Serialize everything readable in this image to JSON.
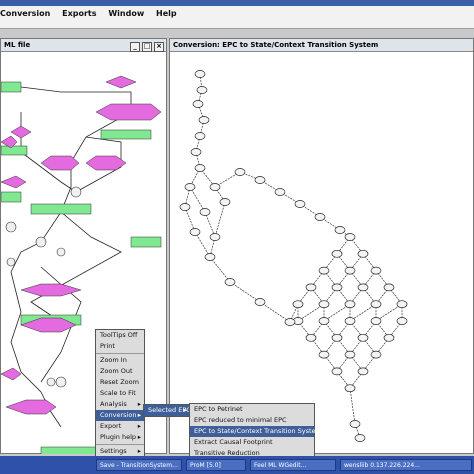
{
  "menubar": {
    "items": [
      "Conversion",
      "Exports",
      "Window",
      "Help"
    ]
  },
  "left_window": {
    "title": "ML file"
  },
  "right_window": {
    "title": "Conversion: EPC to State/Context Transition System"
  },
  "context_menu": {
    "items": [
      "ToolTips Off",
      "Print",
      "Zoom In",
      "Zoom Out",
      "Reset Zoom",
      "Scale to Fit",
      "Analysis",
      "Conversion",
      "Export",
      "Plugin help",
      "Settings"
    ],
    "selected": "Conversion"
  },
  "submenu1": {
    "items": [
      "Selected EPC"
    ]
  },
  "submenu2": {
    "items": [
      "EPC to Petrinet",
      "EPC reduced to minimal EPC",
      "EPC to State/Context Transition System",
      "Extract Causal Footprint",
      "Transitive Reduction"
    ],
    "selected": "EPC to State/Context Transition System"
  },
  "taskbar": {
    "items": [
      "Save - TransitionSystem...",
      "ProM [5.0]",
      "Feel ML WGedit...",
      "wensliib 0.137.226.224..."
    ]
  },
  "colors": {
    "function": "#80e890",
    "event": "#e46ae0",
    "connector": "#f0f0f0",
    "selection": "#3f5f98",
    "taskbar": "#2f52a8"
  }
}
